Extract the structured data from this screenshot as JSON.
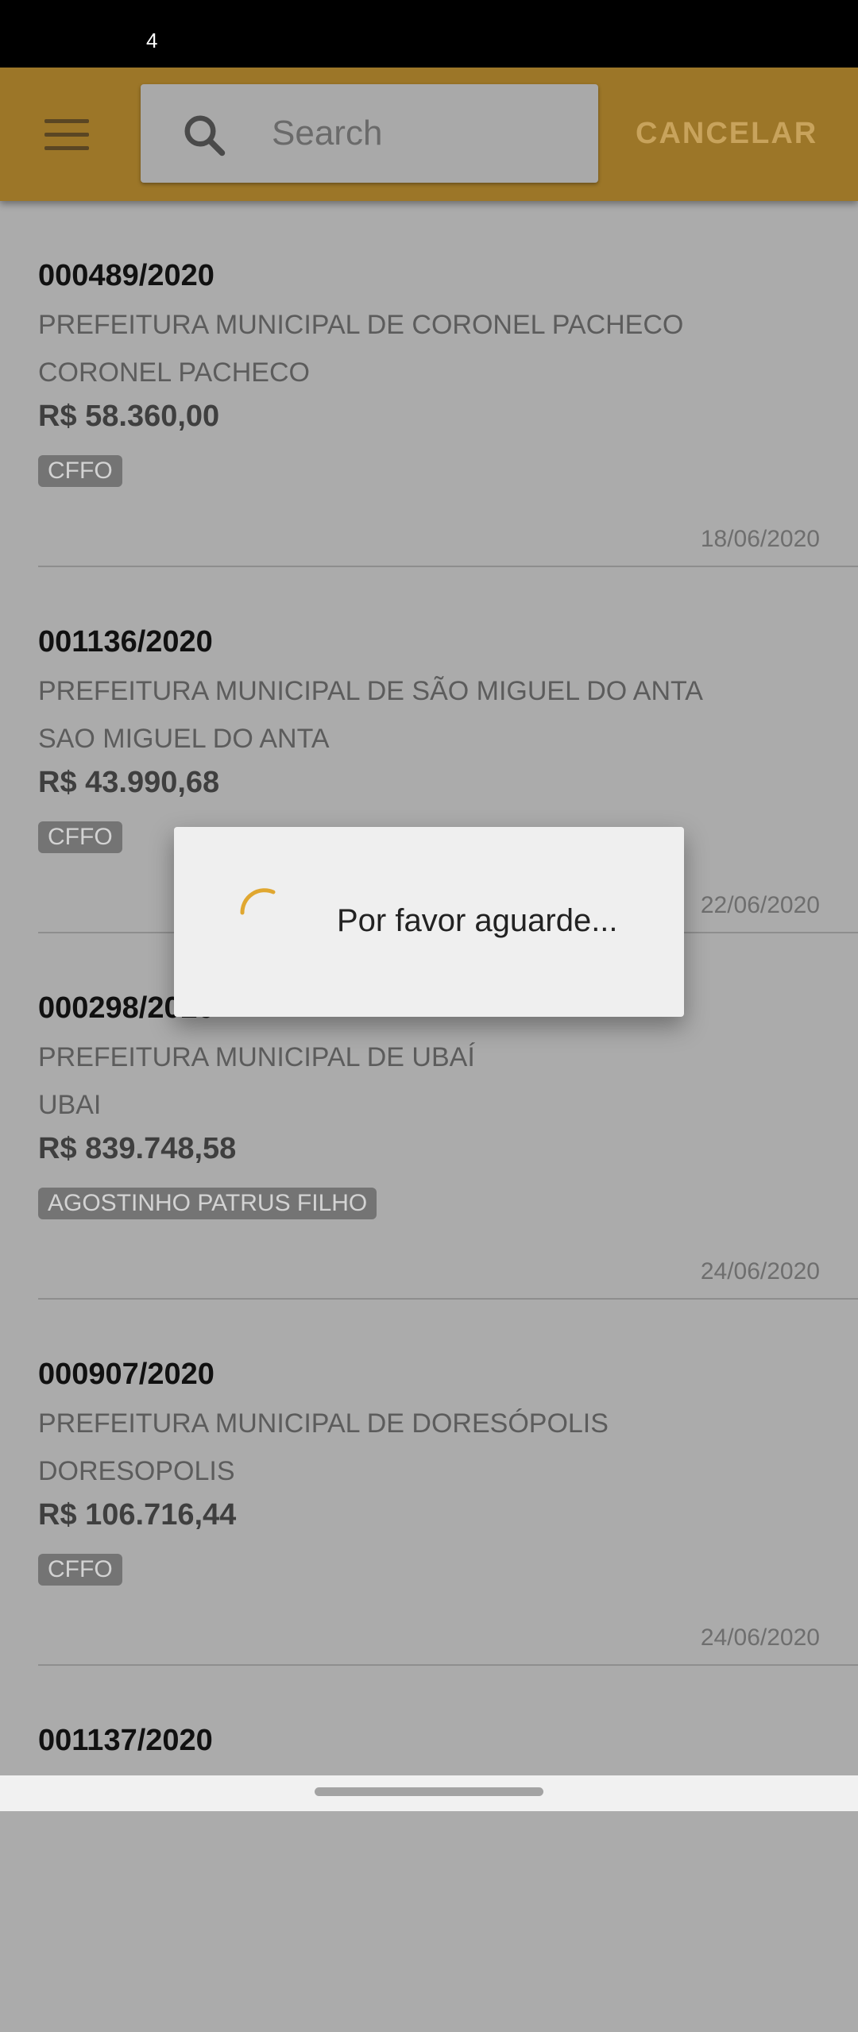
{
  "status_bar": {
    "indicator": "4"
  },
  "toolbar": {
    "menu_icon": "hamburger-menu-icon",
    "search": {
      "placeholder": "Search",
      "value": "",
      "icon": "search-icon"
    },
    "cancel_label": "CANCELAR",
    "accent_color": "#9c7628"
  },
  "list": {
    "items": [
      {
        "code": "000489/2020",
        "org": "PREFEITURA MUNICIPAL DE CORONEL PACHECO",
        "city": "CORONEL PACHECO",
        "amount": "R$ 58.360,00",
        "tag": "CFFO",
        "date": "18/06/2020"
      },
      {
        "code": "001136/2020",
        "org": "PREFEITURA MUNICIPAL DE SÃO MIGUEL DO ANTA",
        "city": "SAO MIGUEL DO ANTA",
        "amount": "R$ 43.990,68",
        "tag": "CFFO",
        "date": "22/06/2020"
      },
      {
        "code": "000298/2020",
        "org": "PREFEITURA MUNICIPAL DE UBAÍ",
        "city": "UBAI",
        "amount": "R$ 839.748,58",
        "tag": "AGOSTINHO PATRUS FILHO",
        "date": "24/06/2020"
      },
      {
        "code": "000907/2020",
        "org": "PREFEITURA MUNICIPAL DE DORESÓPOLIS",
        "city": "DORESOPOLIS",
        "amount": "R$ 106.716,44",
        "tag": "CFFO",
        "date": "24/06/2020"
      },
      {
        "code": "001137/2020"
      }
    ]
  },
  "dialog": {
    "message": "Por favor aguarde...",
    "spinner_color": "#e0a730"
  }
}
